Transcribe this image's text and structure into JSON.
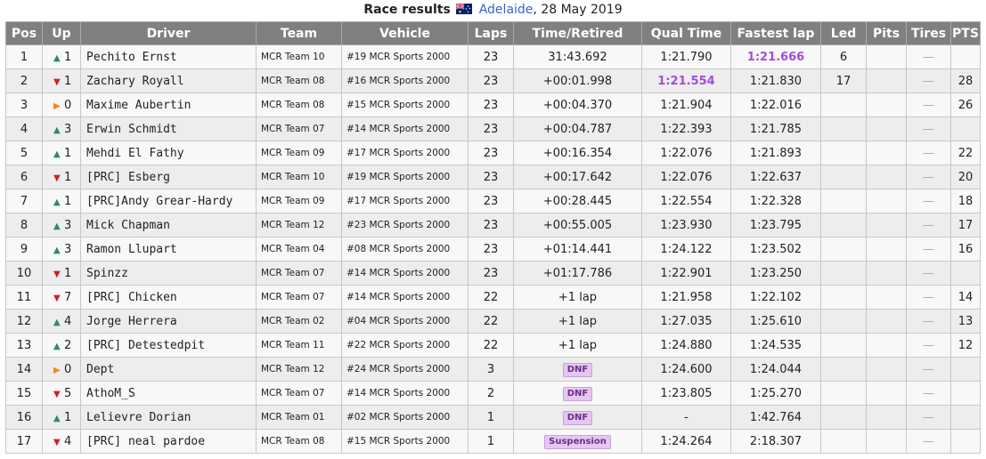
{
  "caption": {
    "title": "Race results",
    "location": "Adelaide",
    "date": ", 28 May 2019"
  },
  "headers": [
    "Pos",
    "Up",
    "Driver",
    "Team",
    "Vehicle",
    "Laps",
    "Time/Retired",
    "Qual Time",
    "Fastest lap",
    "Led",
    "Pits",
    "Tires",
    "PTS"
  ],
  "rows": [
    {
      "pos": "1",
      "dir": "up",
      "up": "1",
      "driver": "Pechito Ernst",
      "team": "MCR Team 10",
      "vehicle": "#19 MCR Sports 2000",
      "laps": "23",
      "time": "31:43.692",
      "time_badge": false,
      "qual": "1:21.790",
      "qual_best": false,
      "fast": "1:21.666",
      "fast_best": true,
      "led": "6",
      "pits": "",
      "tires": "—",
      "pts": ""
    },
    {
      "pos": "2",
      "dir": "down",
      "up": "1",
      "driver": "Zachary Royall",
      "team": "MCR Team 08",
      "vehicle": "#16 MCR Sports 2000",
      "laps": "23",
      "time": "+00:01.998",
      "time_badge": false,
      "qual": "1:21.554",
      "qual_best": true,
      "fast": "1:21.830",
      "fast_best": false,
      "led": "17",
      "pits": "",
      "tires": "—",
      "pts": "28"
    },
    {
      "pos": "3",
      "dir": "same",
      "up": "0",
      "driver": "Maxime Aubertin",
      "team": "MCR Team 08",
      "vehicle": "#15 MCR Sports 2000",
      "laps": "23",
      "time": "+00:04.370",
      "time_badge": false,
      "qual": "1:21.904",
      "qual_best": false,
      "fast": "1:22.016",
      "fast_best": false,
      "led": "",
      "pits": "",
      "tires": "—",
      "pts": "26"
    },
    {
      "pos": "4",
      "dir": "up",
      "up": "3",
      "driver": "Erwin Schmidt",
      "team": "MCR Team 07",
      "vehicle": "#14 MCR Sports 2000",
      "laps": "23",
      "time": "+00:04.787",
      "time_badge": false,
      "qual": "1:22.393",
      "qual_best": false,
      "fast": "1:21.785",
      "fast_best": false,
      "led": "",
      "pits": "",
      "tires": "—",
      "pts": ""
    },
    {
      "pos": "5",
      "dir": "up",
      "up": "1",
      "driver": "Mehdi El Fathy",
      "team": "MCR Team 09",
      "vehicle": "#17 MCR Sports 2000",
      "laps": "23",
      "time": "+00:16.354",
      "time_badge": false,
      "qual": "1:22.076",
      "qual_best": false,
      "fast": "1:21.893",
      "fast_best": false,
      "led": "",
      "pits": "",
      "tires": "—",
      "pts": "22"
    },
    {
      "pos": "6",
      "dir": "down",
      "up": "1",
      "driver": "[PRC] Esberg",
      "team": "MCR Team 10",
      "vehicle": "#19 MCR Sports 2000",
      "laps": "23",
      "time": "+00:17.642",
      "time_badge": false,
      "qual": "1:22.076",
      "qual_best": false,
      "fast": "1:22.637",
      "fast_best": false,
      "led": "",
      "pits": "",
      "tires": "—",
      "pts": "20"
    },
    {
      "pos": "7",
      "dir": "up",
      "up": "1",
      "driver": "[PRC]Andy Grear-Hardy",
      "team": "MCR Team 09",
      "vehicle": "#17 MCR Sports 2000",
      "laps": "23",
      "time": "+00:28.445",
      "time_badge": false,
      "qual": "1:22.554",
      "qual_best": false,
      "fast": "1:22.328",
      "fast_best": false,
      "led": "",
      "pits": "",
      "tires": "—",
      "pts": "18"
    },
    {
      "pos": "8",
      "dir": "up",
      "up": "3",
      "driver": "Mick Chapman",
      "team": "MCR Team 12",
      "vehicle": "#23 MCR Sports 2000",
      "laps": "23",
      "time": "+00:55.005",
      "time_badge": false,
      "qual": "1:23.930",
      "qual_best": false,
      "fast": "1:23.795",
      "fast_best": false,
      "led": "",
      "pits": "",
      "tires": "—",
      "pts": "17"
    },
    {
      "pos": "9",
      "dir": "up",
      "up": "3",
      "driver": "Ramon Llupart",
      "team": "MCR Team 04",
      "vehicle": "#08 MCR Sports 2000",
      "laps": "23",
      "time": "+01:14.441",
      "time_badge": false,
      "qual": "1:24.122",
      "qual_best": false,
      "fast": "1:23.502",
      "fast_best": false,
      "led": "",
      "pits": "",
      "tires": "—",
      "pts": "16"
    },
    {
      "pos": "10",
      "dir": "down",
      "up": "1",
      "driver": "Spinzz",
      "team": "MCR Team 07",
      "vehicle": "#14 MCR Sports 2000",
      "laps": "23",
      "time": "+01:17.786",
      "time_badge": false,
      "qual": "1:22.901",
      "qual_best": false,
      "fast": "1:23.250",
      "fast_best": false,
      "led": "",
      "pits": "",
      "tires": "—",
      "pts": ""
    },
    {
      "pos": "11",
      "dir": "down",
      "up": "7",
      "driver": "[PRC] Chicken",
      "team": "MCR Team 07",
      "vehicle": "#14 MCR Sports 2000",
      "laps": "22",
      "time": "+1 lap",
      "time_badge": false,
      "qual": "1:21.958",
      "qual_best": false,
      "fast": "1:22.102",
      "fast_best": false,
      "led": "",
      "pits": "",
      "tires": "—",
      "pts": "14"
    },
    {
      "pos": "12",
      "dir": "up",
      "up": "4",
      "driver": "Jorge Herrera",
      "team": "MCR Team 02",
      "vehicle": "#04 MCR Sports 2000",
      "laps": "22",
      "time": "+1 lap",
      "time_badge": false,
      "qual": "1:27.035",
      "qual_best": false,
      "fast": "1:25.610",
      "fast_best": false,
      "led": "",
      "pits": "",
      "tires": "—",
      "pts": "13"
    },
    {
      "pos": "13",
      "dir": "up",
      "up": "2",
      "driver": "[PRC] Detestedpit",
      "team": "MCR Team 11",
      "vehicle": "#22 MCR Sports 2000",
      "laps": "22",
      "time": "+1 lap",
      "time_badge": false,
      "qual": "1:24.880",
      "qual_best": false,
      "fast": "1:24.535",
      "fast_best": false,
      "led": "",
      "pits": "",
      "tires": "—",
      "pts": "12"
    },
    {
      "pos": "14",
      "dir": "same",
      "up": "0",
      "driver": "Dept",
      "team": "MCR Team 12",
      "vehicle": "#24 MCR Sports 2000",
      "laps": "3",
      "time": "DNF",
      "time_badge": true,
      "qual": "1:24.600",
      "qual_best": false,
      "fast": "1:24.044",
      "fast_best": false,
      "led": "",
      "pits": "",
      "tires": "—",
      "pts": ""
    },
    {
      "pos": "15",
      "dir": "down",
      "up": "5",
      "driver": "AthoM_S",
      "team": "MCR Team 07",
      "vehicle": "#14 MCR Sports 2000",
      "laps": "2",
      "time": "DNF",
      "time_badge": true,
      "qual": "1:23.805",
      "qual_best": false,
      "fast": "1:25.270",
      "fast_best": false,
      "led": "",
      "pits": "",
      "tires": "—",
      "pts": ""
    },
    {
      "pos": "16",
      "dir": "up",
      "up": "1",
      "driver": "Lelievre Dorian",
      "team": "MCR Team 01",
      "vehicle": "#02 MCR Sports 2000",
      "laps": "1",
      "time": "DNF",
      "time_badge": true,
      "qual": "-",
      "qual_best": false,
      "fast": "1:42.764",
      "fast_best": false,
      "led": "",
      "pits": "",
      "tires": "—",
      "pts": ""
    },
    {
      "pos": "17",
      "dir": "down",
      "up": "4",
      "driver": "[PRC] neal pardoe",
      "team": "MCR Team 08",
      "vehicle": "#15 MCR Sports 2000",
      "laps": "1",
      "time": "Suspension",
      "time_badge": true,
      "qual": "1:24.264",
      "qual_best": false,
      "fast": "2:18.307",
      "fast_best": false,
      "led": "",
      "pits": "",
      "tires": "—",
      "pts": ""
    }
  ],
  "colors": {
    "header_bg": "#808080",
    "best_time": "#a64bd9",
    "arrow_up": "#2e8b57",
    "arrow_down": "#cc2222",
    "arrow_same": "#f08a1c",
    "link": "#3366cc"
  },
  "icons": {
    "flag": "australia-flag-icon",
    "up": "triangle-up-icon",
    "down": "triangle-down-icon",
    "same": "triangle-right-icon"
  }
}
